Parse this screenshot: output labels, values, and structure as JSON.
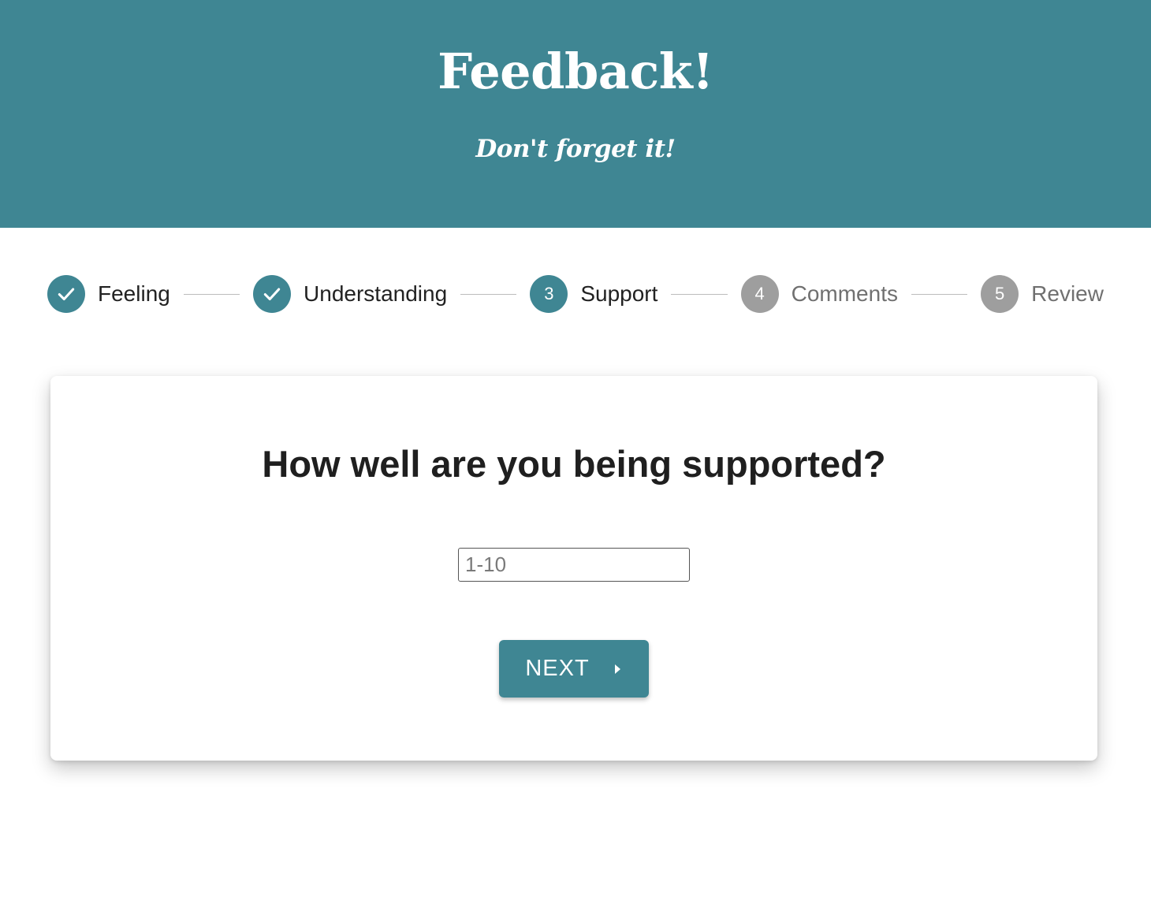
{
  "header": {
    "title": "Feedback!",
    "subtitle": "Don't forget it!"
  },
  "stepper": {
    "steps": [
      {
        "number": "1",
        "label": "Feeling",
        "state": "completed"
      },
      {
        "number": "2",
        "label": "Understanding",
        "state": "completed"
      },
      {
        "number": "3",
        "label": "Support",
        "state": "active"
      },
      {
        "number": "4",
        "label": "Comments",
        "state": "pending"
      },
      {
        "number": "5",
        "label": "Review",
        "state": "pending"
      }
    ]
  },
  "card": {
    "question": "How well are you being supported?",
    "input": {
      "value": "",
      "placeholder": "1-10"
    },
    "next_button": {
      "label": "NEXT",
      "icon": "chevron-right-icon"
    }
  },
  "colors": {
    "accent": "#3f8693",
    "pending": "#9e9e9e",
    "background": "#ffffff"
  }
}
